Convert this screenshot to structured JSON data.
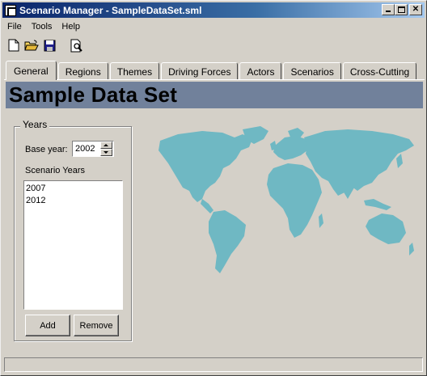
{
  "window": {
    "title": "Scenario Manager - SampleDataSet.sml"
  },
  "menu": {
    "items": [
      "File",
      "Tools",
      "Help"
    ]
  },
  "toolbar": {
    "icons": [
      "new-document-icon",
      "open-folder-icon",
      "save-disk-icon",
      "print-preview-icon"
    ]
  },
  "tabs": [
    "General",
    "Regions",
    "Themes",
    "Driving Forces",
    "Actors",
    "Scenarios",
    "Cross-Cutting"
  ],
  "active_tab": "General",
  "header": {
    "title": "Sample Data Set",
    "band_color": "#71819b"
  },
  "years_group": {
    "legend": "Years",
    "base_year_label": "Base year:",
    "base_year_value": "2002",
    "scenario_years_label": "Scenario Years",
    "scenario_years": [
      "2007",
      "2012"
    ],
    "add_label": "Add",
    "remove_label": "Remove"
  },
  "colors": {
    "map": "#6fb8c3",
    "window_bg": "#d4d0c8"
  }
}
